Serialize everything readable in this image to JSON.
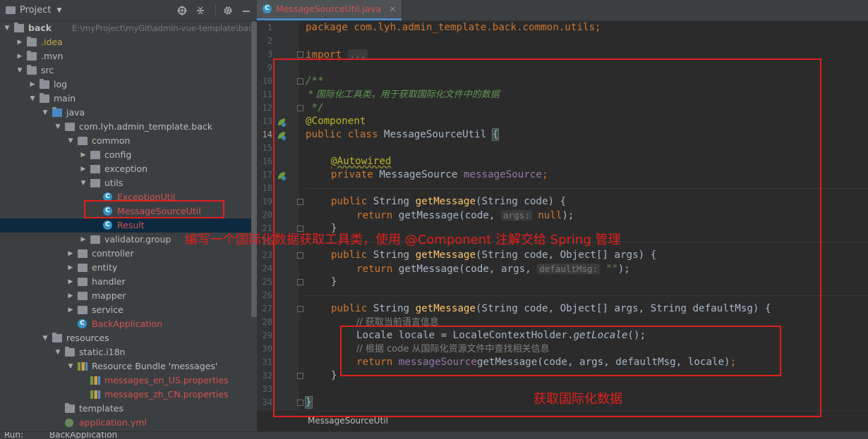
{
  "project": {
    "title": "Project",
    "root_name": "back",
    "root_path": "E:\\myProject\\myGit\\admin-vue-template\\back"
  },
  "tree": [
    {
      "label": "back",
      "depth": 0,
      "arrow": "down",
      "icon": "folder",
      "sub": "E:\\myProject\\myGit\\admin-vue-template\\back"
    },
    {
      "label": ".idea",
      "depth": 1,
      "arrow": "right",
      "icon": "folder",
      "tone": "idea"
    },
    {
      "label": ".mvn",
      "depth": 1,
      "arrow": "right",
      "icon": "folder"
    },
    {
      "label": "src",
      "depth": 1,
      "arrow": "down",
      "icon": "folder"
    },
    {
      "label": "log",
      "depth": 2,
      "arrow": "right",
      "icon": "folder"
    },
    {
      "label": "main",
      "depth": 2,
      "arrow": "down",
      "icon": "folder"
    },
    {
      "label": "java",
      "depth": 3,
      "arrow": "down",
      "icon": "folder-src"
    },
    {
      "label": "com.lyh.admin_template.back",
      "depth": 4,
      "arrow": "down",
      "icon": "package"
    },
    {
      "label": "common",
      "depth": 5,
      "arrow": "down",
      "icon": "package"
    },
    {
      "label": "config",
      "depth": 6,
      "arrow": "right",
      "icon": "package"
    },
    {
      "label": "exception",
      "depth": 6,
      "arrow": "right",
      "icon": "package"
    },
    {
      "label": "utils",
      "depth": 6,
      "arrow": "down",
      "icon": "package"
    },
    {
      "label": "ExceptionUtil",
      "depth": 7,
      "arrow": "",
      "icon": "class",
      "tone": "red"
    },
    {
      "label": "MessageSourceUtil",
      "depth": 7,
      "arrow": "",
      "icon": "class",
      "tone": "red"
    },
    {
      "label": "Result",
      "depth": 7,
      "arrow": "",
      "icon": "class",
      "tone": "red",
      "selected": true
    },
    {
      "label": "validator.group",
      "depth": 6,
      "arrow": "right",
      "icon": "package"
    },
    {
      "label": "controller",
      "depth": 5,
      "arrow": "right",
      "icon": "package"
    },
    {
      "label": "entity",
      "depth": 5,
      "arrow": "right",
      "icon": "package"
    },
    {
      "label": "handler",
      "depth": 5,
      "arrow": "right",
      "icon": "package"
    },
    {
      "label": "mapper",
      "depth": 5,
      "arrow": "right",
      "icon": "package"
    },
    {
      "label": "service",
      "depth": 5,
      "arrow": "right",
      "icon": "package"
    },
    {
      "label": "BackApplication",
      "depth": 5,
      "arrow": "",
      "icon": "boot-class",
      "tone": "red"
    },
    {
      "label": "resources",
      "depth": 3,
      "arrow": "down",
      "icon": "folder-res"
    },
    {
      "label": "static.i18n",
      "depth": 4,
      "arrow": "down",
      "icon": "folder"
    },
    {
      "label": "Resource Bundle 'messages'",
      "depth": 5,
      "arrow": "down",
      "icon": "bundle"
    },
    {
      "label": "messages_en_US.properties",
      "depth": 6,
      "arrow": "",
      "icon": "properties",
      "tone": "red"
    },
    {
      "label": "messages_zh_CN.properties",
      "depth": 6,
      "arrow": "",
      "icon": "properties",
      "tone": "red"
    },
    {
      "label": "templates",
      "depth": 4,
      "arrow": "",
      "icon": "folder"
    },
    {
      "label": "application.yml",
      "depth": 4,
      "arrow": "",
      "icon": "yml",
      "tone": "red"
    }
  ],
  "editor": {
    "tab_label": "MessageSourceUtil.java",
    "tab_close": "×",
    "breadcrumb": "MessageSourceUtil"
  },
  "line_numbers": [
    "1",
    "2",
    "3",
    "9",
    "10",
    "11",
    "12",
    "13",
    "14",
    "15",
    "16",
    "17",
    "18",
    "19",
    "20",
    "21",
    "22",
    "23",
    "24",
    "25",
    "26",
    "27",
    "28",
    "29",
    "30",
    "31",
    "32",
    "33",
    "34"
  ],
  "code": {
    "l1": "package com.lyh.admin_template.back.common.utils;",
    "l3_kw": "import",
    "l3_fold": "...",
    "l10": "/**",
    "l11": " * 国际化工具类，用于获取国际化文件中的数据",
    "l12": " */",
    "l13": "@Component",
    "l14_a": "public class ",
    "l14_b": "MessageSourceUtil ",
    "l14_c": "{",
    "l16": "@Autowired",
    "l17_a": "private ",
    "l17_b": "MessageSource ",
    "l17_c": "messageSource",
    ";": ";",
    "l19_a": "public ",
    "l19_b": "String ",
    "l19_c": "getMessage",
    "l19_d": "(String code) {",
    "l20_a": "return ",
    "l20_b": "getMessage(code, ",
    "l20_hint": "args:",
    "l20_c": " null",
    ");": ");",
    "l21": "}",
    "l23_a": "public ",
    "l23_b": "String ",
    "l23_c": "getMessage",
    "l23_d": "(String code, Object[] args) {",
    "l24_a": "return ",
    "l24_b": "getMessage(code, args, ",
    "l24_hint": "defaultMsg:",
    "l24_c": " \"\"",
    "l25": "}",
    "l27_a": "public ",
    "l27_b": "String ",
    "l27_c": "getMessage",
    "l27_d": "(String code, Object[] args, String defaultMsg) {",
    "l28": "// 获取当前语言信息",
    "l29_a": "Locale locale = LocaleContextHolder.",
    "l29_b": "getLocale",
    "l29_c": "();",
    "l30": "// 根据 code 从国际化资源文件中查找相关信息",
    "l31_a": "return ",
    "l31_b": "messageSource",
    ".": ".",
    "l31_c": "getMessage(code, args, defaultMsg, locale)",
    "l32": "}",
    "l34": "}"
  },
  "annotations": {
    "note1": "编写一个国际化数据获取工具类，使用 @Component 注解交给 Spring 管理",
    "note2": "获取国际化数据"
  },
  "run": {
    "label": "Run:",
    "config": "BackApplication"
  },
  "colors": {
    "annotation_red": "#e0201e",
    "keyword": "#cc7832",
    "annotation": "#bbb529",
    "comment": "#629755",
    "function": "#ffc66d",
    "field": "#9876aa"
  }
}
